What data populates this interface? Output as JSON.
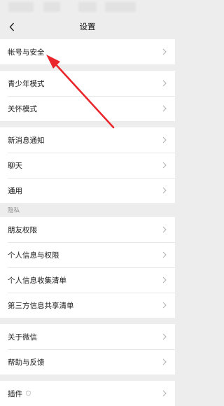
{
  "nav": {
    "title": "设置"
  },
  "groups": [
    {
      "items": [
        {
          "label": "帐号与安全"
        }
      ]
    },
    {
      "items": [
        {
          "label": "青少年模式"
        },
        {
          "label": "关怀模式"
        }
      ]
    },
    {
      "items": [
        {
          "label": "新消息通知"
        },
        {
          "label": "聊天"
        },
        {
          "label": "通用"
        }
      ]
    },
    {
      "header": "隐私",
      "items": [
        {
          "label": "朋友权限"
        },
        {
          "label": "个人信息与权限"
        },
        {
          "label": "个人信息收集清单"
        },
        {
          "label": "第三方信息共享清单"
        }
      ]
    },
    {
      "items": [
        {
          "label": "关于微信"
        },
        {
          "label": "帮助与反馈"
        }
      ]
    },
    {
      "items": [
        {
          "label": "插件",
          "icon": "shield-icon"
        }
      ]
    }
  ],
  "icons": {
    "back": "chevron-left-icon",
    "row_chevron": "chevron-right-icon"
  },
  "colors": {
    "background": "#ededed",
    "row_background": "#ffffff",
    "annotation_arrow": "#e8262b"
  }
}
